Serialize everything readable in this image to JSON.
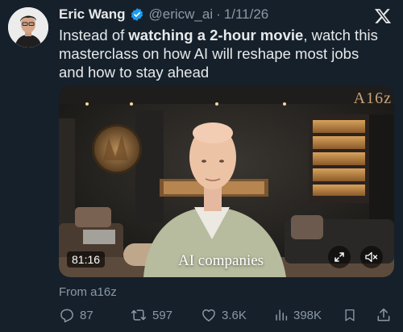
{
  "author": {
    "name": "Eric Wang",
    "handle": "@ericw_ai",
    "separator": "·",
    "date": "1/11/26"
  },
  "tweet": {
    "text_part1": "Instead of ",
    "text_bold": "watching a 2-hour movie",
    "text_part2": ", watch this masterclass on how AI will reshape most jobs and how to stay ahead"
  },
  "video": {
    "caption": "AI companies",
    "duration": "81:16",
    "watermark": "A16z"
  },
  "source": {
    "label": "From a16z"
  },
  "actions": {
    "replies": "87",
    "reposts": "597",
    "likes": "3.6K",
    "views": "398K"
  },
  "colors": {
    "background": "#15202b",
    "verified_badge": "#1d9bf0",
    "secondary_text": "#8b98a5"
  },
  "icons": [
    "x-logo-icon",
    "verified-badge-icon",
    "reply-icon",
    "repost-icon",
    "like-icon",
    "views-icon",
    "bookmark-icon",
    "share-icon",
    "fullscreen-icon",
    "mute-icon"
  ]
}
